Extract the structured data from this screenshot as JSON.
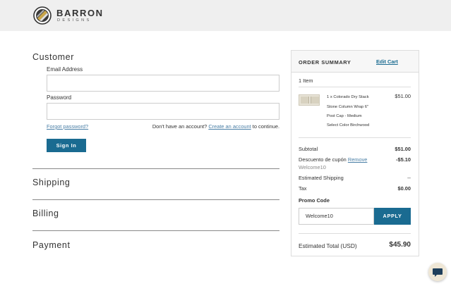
{
  "header": {
    "brand_name": "BARRON",
    "brand_sub": "DESIGNS"
  },
  "checkout": {
    "customer": {
      "title": "Customer",
      "email_label": "Email Address",
      "email_value": "",
      "password_label": "Password",
      "password_value": "",
      "forgot_link": "Forgot password?",
      "account_prefix": "Don't have an account?",
      "create_link": "Create an account",
      "account_suffix": "to continue.",
      "sign_in": "Sign In"
    },
    "shipping_title": "Shipping",
    "billing_title": "Billing",
    "payment_title": "Payment"
  },
  "summary": {
    "title": "ORDER SUMMARY",
    "edit_cart": "Edit Cart",
    "item_count": "1 Item",
    "item": {
      "name_line1": "1 x Colorado Dry Stack",
      "name_line2": "Stone Column Wrap 6\"",
      "name_line3": "Post Cap - Medium",
      "option": "Select Color Birchwood",
      "price": "$51.00"
    },
    "subtotal_label": "Subtotal",
    "subtotal_value": "$51.00",
    "discount_label": "Descuento de cupón",
    "discount_remove": "Remove",
    "discount_value": "-$5.10",
    "discount_code": "Welcome10",
    "shipping_label": "Estimated Shipping",
    "shipping_value": "--",
    "tax_label": "Tax",
    "tax_value": "$0.00",
    "promo_label": "Promo Code",
    "promo_value": "Welcome10",
    "apply": "APPLY",
    "total_label": "Estimated Total (USD)",
    "total_value": "$45.90"
  },
  "colors": {
    "accent": "#1a6b91",
    "link": "#4a7fa6",
    "header_bg": "#efefef"
  },
  "icons": {
    "logo": "barron-logo-icon",
    "chat": "chat-bubble-icon"
  }
}
